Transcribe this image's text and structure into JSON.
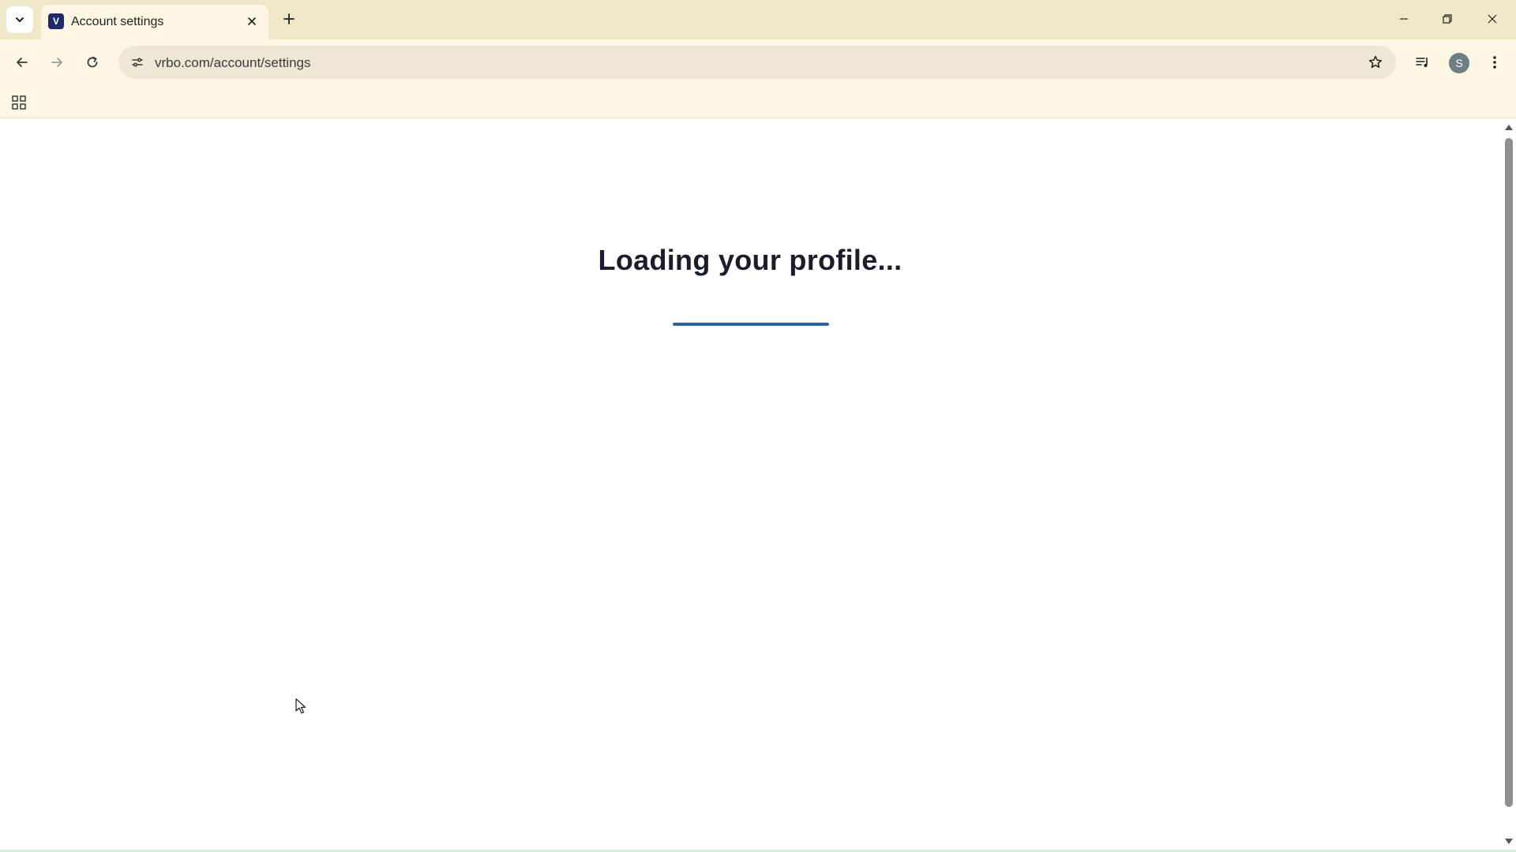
{
  "browser": {
    "tab": {
      "title": "Account settings",
      "favicon": "vrbo-favicon"
    },
    "url": "vrbo.com/account/settings",
    "profile_initial": "S"
  },
  "page": {
    "loading_text": "Loading your profile...",
    "loading_progress_percent": 100
  },
  "colors": {
    "tabstrip_bg": "#efe7c8",
    "toolbar_bg": "#fdf6e4",
    "accent_progress": "#2b5fa6",
    "heading": "#1a1d2e"
  },
  "icons": [
    "tab-search-icon",
    "close-icon",
    "plus-icon",
    "minimize-icon",
    "restore-icon",
    "back-arrow-icon",
    "forward-arrow-icon",
    "reload-icon",
    "site-info-icon",
    "star-icon",
    "media-control-icon",
    "kebab-menu-icon",
    "apps-grid-icon"
  ]
}
